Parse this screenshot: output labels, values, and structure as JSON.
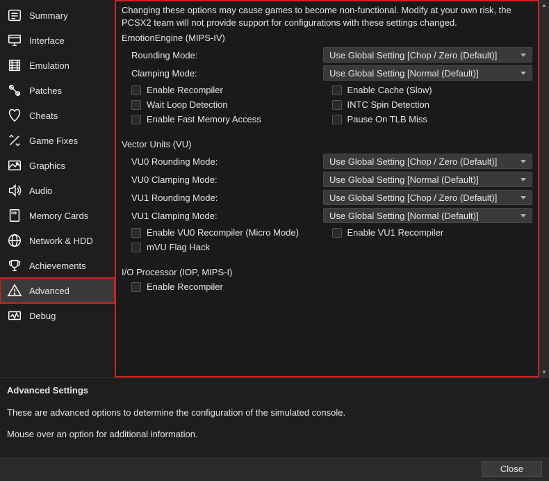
{
  "sidebar": {
    "items": [
      {
        "label": "Summary"
      },
      {
        "label": "Interface"
      },
      {
        "label": "Emulation"
      },
      {
        "label": "Patches"
      },
      {
        "label": "Cheats"
      },
      {
        "label": "Game Fixes"
      },
      {
        "label": "Graphics"
      },
      {
        "label": "Audio"
      },
      {
        "label": "Memory Cards"
      },
      {
        "label": "Network & HDD"
      },
      {
        "label": "Achievements"
      },
      {
        "label": "Advanced"
      },
      {
        "label": "Debug"
      }
    ]
  },
  "content": {
    "warning": "Changing these options may cause games to become non-functional. Modify at your own risk, the PCSX2 team will not provide support for configurations with these settings changed.",
    "ee": {
      "title": "EmotionEngine (MIPS-IV)",
      "rounding_label": "Rounding Mode:",
      "rounding_value": "Use Global Setting [Chop / Zero (Default)]",
      "clamping_label": "Clamping Mode:",
      "clamping_value": "Use Global Setting [Normal (Default)]",
      "chk_enable_recompiler": "Enable Recompiler",
      "chk_enable_cache": "Enable Cache (Slow)",
      "chk_wait_loop": "Wait Loop Detection",
      "chk_intc_spin": "INTC Spin Detection",
      "chk_fast_mem": "Enable Fast Memory Access",
      "chk_pause_tlb": "Pause On TLB Miss"
    },
    "vu": {
      "title": "Vector Units (VU)",
      "vu0_rounding_label": "VU0 Rounding Mode:",
      "vu0_rounding_value": "Use Global Setting [Chop / Zero (Default)]",
      "vu0_clamping_label": "VU0 Clamping Mode:",
      "vu0_clamping_value": "Use Global Setting [Normal (Default)]",
      "vu1_rounding_label": "VU1 Rounding Mode:",
      "vu1_rounding_value": "Use Global Setting [Chop / Zero (Default)]",
      "vu1_clamping_label": "VU1 Clamping Mode:",
      "vu1_clamping_value": "Use Global Setting [Normal (Default)]",
      "chk_vu0_recompiler": "Enable VU0 Recompiler (Micro Mode)",
      "chk_vu1_recompiler": "Enable VU1 Recompiler",
      "chk_mvu_flag": "mVU Flag Hack"
    },
    "iop": {
      "title": "I/O Processor (IOP, MIPS-I)",
      "chk_enable_recompiler": "Enable Recompiler"
    }
  },
  "info": {
    "title": "Advanced Settings",
    "line1": "These are advanced options to determine the configuration of the simulated console.",
    "line2": "Mouse over an option for additional information."
  },
  "footer": {
    "close": "Close"
  }
}
